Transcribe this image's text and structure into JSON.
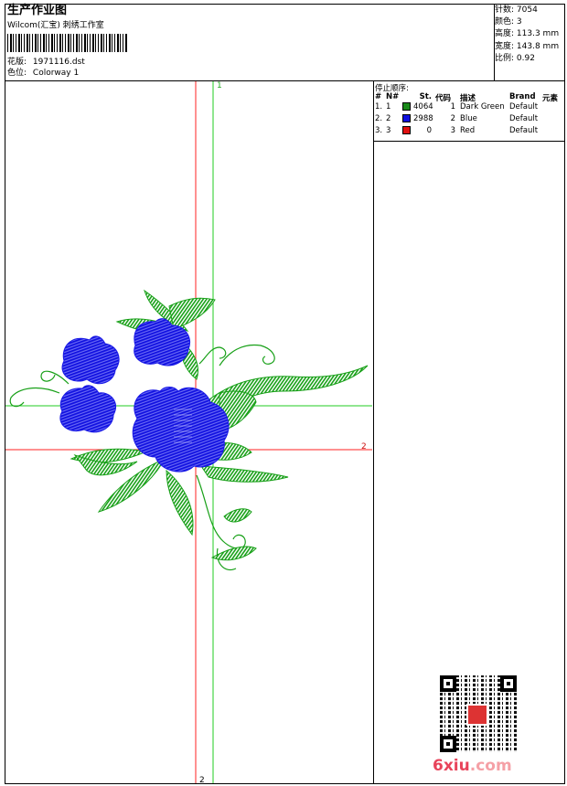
{
  "header": {
    "title": "生产作业图",
    "company": "Wilcom(汇宝) 刺绣工作室",
    "design_label": "花版:",
    "design_value": "1971116.dst",
    "colorway_label": "色位:",
    "colorway_value": "Colorway 1"
  },
  "stats": {
    "stitches_label": "针数:",
    "stitches_value": "7054",
    "colors_label": "颜色:",
    "colors_value": "3",
    "height_label": "高度:",
    "height_value": "113.3 mm",
    "width_label": "宽度:",
    "width_value": "143.8 mm",
    "scale_label": "比例:",
    "scale_value": "0.92"
  },
  "stop_table": {
    "caption": "停止顺序:",
    "headers": [
      "#",
      "N#",
      "St.",
      "代码",
      "描述",
      "Brand",
      "元素"
    ],
    "rows": [
      {
        "idx": "1.",
        "n": "1",
        "color": "#1a8a1a",
        "stitches": "4064",
        "code": "1",
        "desc": "Dark Green",
        "brand": "Default"
      },
      {
        "idx": "2.",
        "n": "2",
        "color": "#1010e0",
        "stitches": "2988",
        "code": "2",
        "desc": "Blue",
        "brand": "Default"
      },
      {
        "idx": "3.",
        "n": "3",
        "color": "#e01010",
        "stitches": "0",
        "code": "3",
        "desc": "Red",
        "brand": "Default"
      }
    ]
  },
  "axes": {
    "green_label": "1",
    "red_right_label": "2",
    "red_bottom_label": "2"
  },
  "colors": {
    "green_axis": "#22cc22",
    "red_axis": "#ff2222",
    "leaf": "#18a018",
    "flower": "#1a1ae6"
  },
  "watermark": {
    "brand": "6xiu",
    "brand_suffix": ".com",
    "seal_icon": "seal-icon",
    "qr_icon": "qr-code-icon"
  }
}
